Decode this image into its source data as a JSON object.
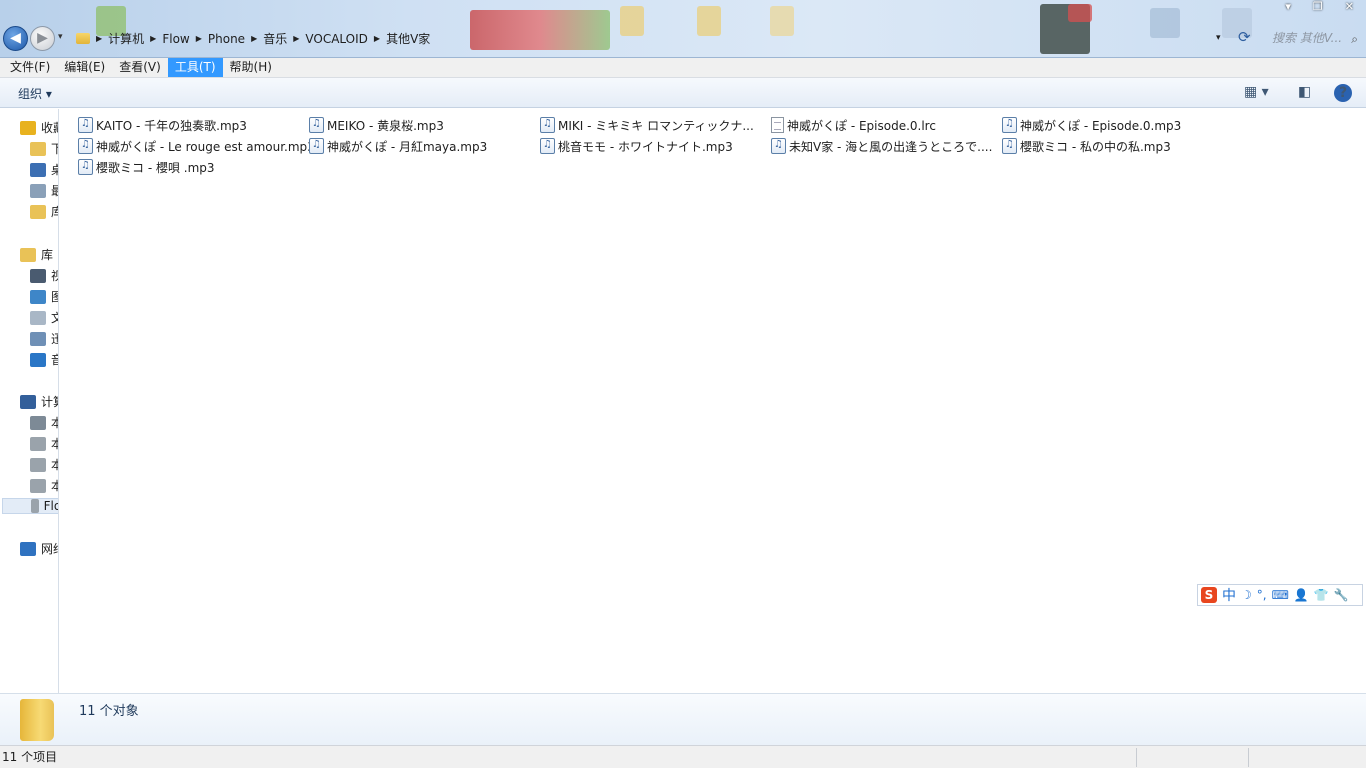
{
  "window": {
    "controls": {
      "minimize": "▾",
      "maximize": "❐",
      "close": "✕"
    }
  },
  "nav": {
    "back_icon": "arrow-left-icon",
    "forward_icon": "arrow-right-icon",
    "history_glyph": "▾"
  },
  "address_bar": {
    "segments": [
      "计算机",
      "Flow",
      "Phone",
      "音乐",
      "VOCALOID",
      "其他V家"
    ],
    "separator_glyph": "▶",
    "dropdown_glyph": "▾",
    "refresh_glyph": "⟳"
  },
  "search": {
    "placeholder": "搜索 其他V...",
    "icon_glyph": "⌕"
  },
  "menu": {
    "items": [
      "文件(F)",
      "编辑(E)",
      "查看(V)",
      "工具(T)",
      "帮助(H)"
    ],
    "active_index": 3
  },
  "command_bar": {
    "organize_label": "组织 ▾",
    "view_glyph": "▦ ▾",
    "preview_glyph": "◧",
    "help_glyph": "?"
  },
  "nav_pane": {
    "items": [
      {
        "label": "收藏夹",
        "icon": "star-icon",
        "color": "#e8b21f"
      },
      {
        "label": "下载",
        "icon": "folder-icon",
        "color": "#e9c257"
      },
      {
        "label": "桌面",
        "icon": "desktop-icon",
        "color": "#3c6fb3"
      },
      {
        "label": "最近访问的位置",
        "icon": "recent-places-icon",
        "color": "#8aa0b8"
      },
      {
        "label": "库",
        "icon": "library-folder-icon",
        "color": "#e9c257"
      },
      {
        "label": "库",
        "icon": "library-icon",
        "color": "#e9c257"
      },
      {
        "label": "视频",
        "icon": "video-icon",
        "color": "#4a5b70"
      },
      {
        "label": "图片",
        "icon": "picture-icon",
        "color": "#3e86c8"
      },
      {
        "label": "文档",
        "icon": "document-icon",
        "color": "#a9b7c6"
      },
      {
        "label": "迅雷下载",
        "icon": "download-doc-icon",
        "color": "#6f90b6"
      },
      {
        "label": "音乐",
        "icon": "music-icon",
        "color": "#2a76c6"
      },
      {
        "label": "计算机",
        "icon": "computer-icon",
        "color": "#335f9a"
      },
      {
        "label": "本地磁盘",
        "icon": "system-drive-icon",
        "color": "#7d8a96"
      },
      {
        "label": "本地磁盘",
        "icon": "drive-icon",
        "color": "#9aa3ab"
      },
      {
        "label": "本地磁盘",
        "icon": "drive-icon",
        "color": "#9aa3ab"
      },
      {
        "label": "本地磁盘",
        "icon": "drive-icon",
        "color": "#9aa3ab"
      },
      {
        "label": "Flow",
        "icon": "removable-drive-icon",
        "color": "#9aa3ab"
      },
      {
        "label": "网络",
        "icon": "network-icon",
        "color": "#2f72c0"
      }
    ]
  },
  "files": [
    {
      "name": "KAITO - 千年の独奏歌.mp3",
      "type": "mp3"
    },
    {
      "name": "MEIKO - 黄泉桜.mp3",
      "type": "mp3"
    },
    {
      "name": "MIKI - ミキミキ ロマンティックナ...",
      "type": "mp3"
    },
    {
      "name": "神威がくぽ - Episode.0.lrc",
      "type": "lrc"
    },
    {
      "name": "神威がくぽ - Episode.0.mp3",
      "type": "mp3"
    },
    {
      "name": "神威がくぽ - Le rouge est amour.mp3",
      "type": "mp3"
    },
    {
      "name": "神威がくぽ - 月紅maya.mp3",
      "type": "mp3"
    },
    {
      "name": "桃音モモ - ホワイトナイト.mp3",
      "type": "mp3"
    },
    {
      "name": "未知V家 - 海と風の出逢うところで....",
      "type": "mp3"
    },
    {
      "name": "櫻歌ミコ - 私の中の私.mp3",
      "type": "mp3"
    },
    {
      "name": "櫻歌ミコ - 櫻唄 .mp3",
      "type": "mp3"
    }
  ],
  "ime_toolbar": {
    "logo": "S",
    "mode": "中",
    "glyphs": [
      "☽",
      "°,",
      "⌨",
      "👤",
      "👕",
      "🔧"
    ],
    "accent": "#1f6fd0"
  },
  "details": {
    "count_text": "11 个对象"
  },
  "status_bar": {
    "text": "11 个项目"
  }
}
